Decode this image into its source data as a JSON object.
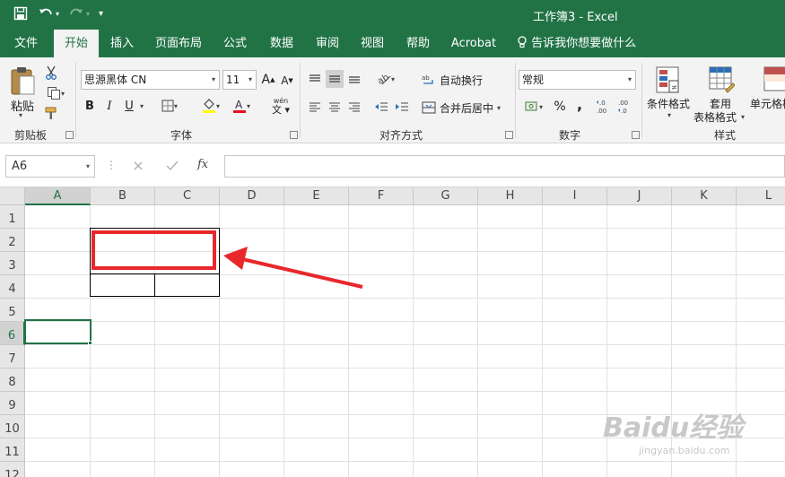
{
  "window": {
    "title": "工作簿3  -  Excel"
  },
  "tabs": [
    {
      "label": "文件"
    },
    {
      "label": "开始"
    },
    {
      "label": "插入"
    },
    {
      "label": "页面布局"
    },
    {
      "label": "公式"
    },
    {
      "label": "数据"
    },
    {
      "label": "审阅"
    },
    {
      "label": "视图"
    },
    {
      "label": "帮助"
    },
    {
      "label": "Acrobat"
    },
    {
      "label": "告诉我你想要做什么"
    }
  ],
  "ribbon": {
    "clipboard": {
      "paste_label": "粘贴",
      "group_label": "剪贴板"
    },
    "font": {
      "font_name": "思源黑体 CN",
      "font_size": "11",
      "bold": "B",
      "italic": "I",
      "underline": "U",
      "grow": "A",
      "shrink": "A",
      "group_label": "字体",
      "font_color": "#e81123",
      "highlight_color": "#ffff00",
      "wen_label": "wén"
    },
    "alignment": {
      "wrap_label": "自动换行",
      "merge_label": "合并后居中",
      "group_label": "对齐方式"
    },
    "number": {
      "format_value": "常规",
      "percent": "%",
      "comma": ",",
      "group_label": "数字"
    },
    "styles": {
      "conditional_label": "条件格式",
      "table_label_1": "套用",
      "table_label_2": "表格格式",
      "cell_label": "单元格样",
      "group_label": "样式"
    }
  },
  "formula_bar": {
    "name_box": "A6",
    "formula": ""
  },
  "sheet": {
    "columns": [
      "A",
      "B",
      "C",
      "D",
      "E",
      "F",
      "G",
      "H",
      "I",
      "J",
      "K",
      "L"
    ],
    "rows": [
      "1",
      "2",
      "3",
      "4",
      "5",
      "6",
      "7",
      "8",
      "9",
      "10",
      "11",
      "12"
    ],
    "selected_column": "A",
    "selected_row": "6",
    "active_cell": "A6"
  },
  "annotation": {
    "highlight_color": "#e8282b",
    "arrow_color": "#e8282b"
  },
  "watermark": {
    "brand": "Baidu经验",
    "url": "jingyan.baidu.com"
  },
  "colors": {
    "accent": "#217346"
  }
}
